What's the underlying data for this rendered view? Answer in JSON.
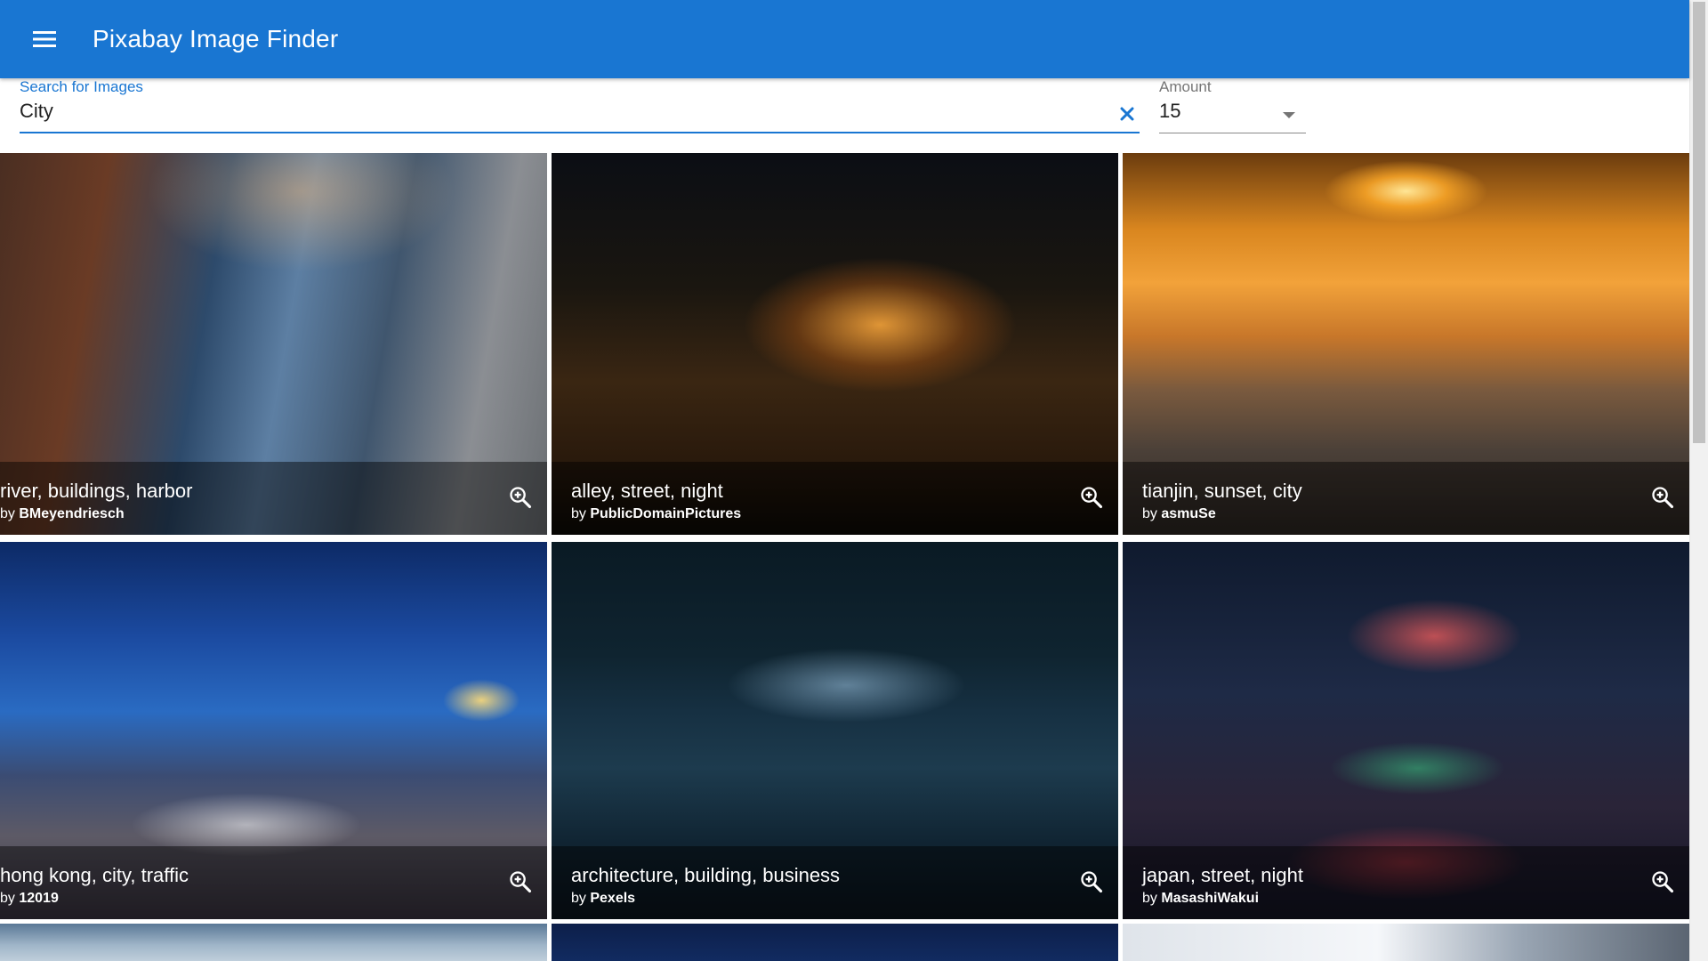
{
  "appbar": {
    "title": "Pixabay Image Finder",
    "menu_icon": "menu-icon",
    "color": "#1976d2"
  },
  "search": {
    "label": "Search for Images",
    "value": "City",
    "clear_icon": "close-icon"
  },
  "amount": {
    "label": "Amount",
    "value": "15",
    "icon": "dropdown-arrow-icon"
  },
  "images": [
    {
      "title": "river, buildings, harbor",
      "by_prefix": "by",
      "author": "BMeyendriesch",
      "zoom_icon": "zoom-in-icon"
    },
    {
      "title": "alley, street, night",
      "by_prefix": "by",
      "author": "PublicDomainPictures",
      "zoom_icon": "zoom-in-icon"
    },
    {
      "title": "tianjin, sunset, city",
      "by_prefix": "by",
      "author": "asmuSe",
      "zoom_icon": "zoom-in-icon"
    },
    {
      "title": "hong kong, city, traffic",
      "by_prefix": "by",
      "author": "12019",
      "zoom_icon": "zoom-in-icon"
    },
    {
      "title": "architecture, building, business",
      "by_prefix": "by",
      "author": "Pexels",
      "zoom_icon": "zoom-in-icon"
    },
    {
      "title": "japan, street, night",
      "by_prefix": "by",
      "author": "MasashiWakui",
      "zoom_icon": "zoom-in-icon"
    }
  ]
}
